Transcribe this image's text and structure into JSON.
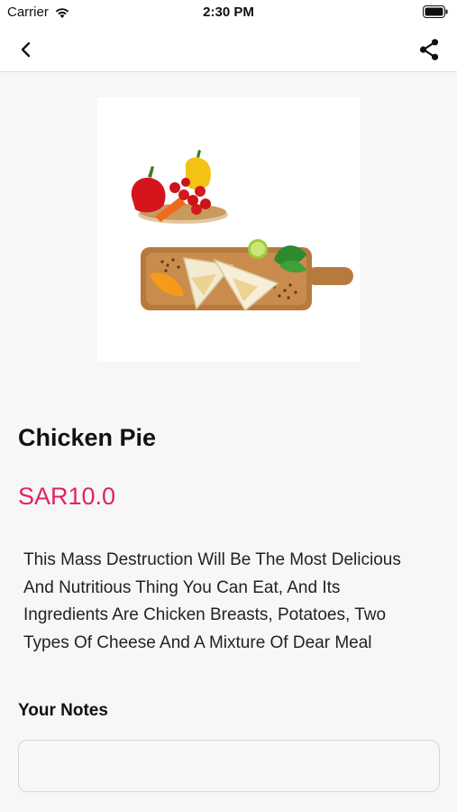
{
  "status_bar": {
    "carrier": "Carrier",
    "time": "2:30 PM"
  },
  "nav": {
    "back_icon": "chevron-left-icon",
    "share_icon": "share-icon"
  },
  "product": {
    "name": "Chicken Pie",
    "price": "SAR10.0",
    "description": "This Mass Destruction Will Be The Most Delicious And Nutritious Thing You Can Eat, And Its Ingredients Are Chicken Breasts, Potatoes, Two Types Of Cheese And A Mixture Of Dear Meal",
    "price_color": "#e0245e"
  },
  "notes": {
    "label": "Your Notes",
    "value": "",
    "placeholder": ""
  }
}
